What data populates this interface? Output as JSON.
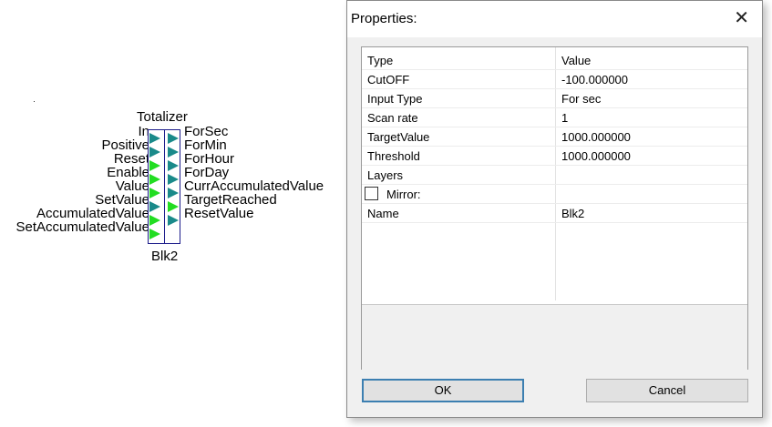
{
  "block": {
    "title": "Totalizer",
    "name": "Blk2",
    "inputs": [
      "In",
      "Positive",
      "Reset",
      "Enable",
      "Value",
      "SetValue",
      "AccumulatedValue",
      "SetAccumulatedValue"
    ],
    "outputs": [
      "ForSec",
      "ForMin",
      "ForHour",
      "ForDay",
      "CurrAccumulatedValue",
      "TargetReached",
      "ResetValue"
    ],
    "colors": {
      "input_triangle": "#22dd22",
      "output_triangle": "#1a8a8a",
      "border": "#1c1c8a"
    }
  },
  "dialog": {
    "title": "Properties:",
    "close_icon": "close-icon",
    "grid": {
      "header": {
        "col1": "Type",
        "col2": "Value"
      },
      "rows": [
        {
          "name": "CutOFF",
          "value": "-100.000000"
        },
        {
          "name": "Input Type",
          "value": "For sec"
        },
        {
          "name": "Scan rate",
          "value": "1"
        },
        {
          "name": "TargetValue",
          "value": "1000.000000"
        },
        {
          "name": "Threshold",
          "value": "1000.000000"
        },
        {
          "name": "Layers",
          "value": ""
        }
      ],
      "mirror": {
        "label": "Mirror:",
        "checked": false
      },
      "name_row": {
        "name": "Name",
        "value": "Blk2"
      }
    },
    "buttons": {
      "ok": "OK",
      "cancel": "Cancel"
    }
  }
}
